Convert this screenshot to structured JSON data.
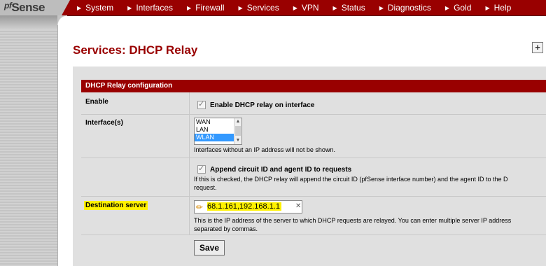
{
  "logo": {
    "prefix": "pf",
    "name": "Sense"
  },
  "nav": [
    {
      "label": "System"
    },
    {
      "label": "Interfaces"
    },
    {
      "label": "Firewall"
    },
    {
      "label": "Services"
    },
    {
      "label": "VPN"
    },
    {
      "label": "Status"
    },
    {
      "label": "Diagnostics"
    },
    {
      "label": "Gold"
    },
    {
      "label": "Help"
    }
  ],
  "page": {
    "title": "Services: DHCP Relay",
    "add_icon": "add-icon"
  },
  "section": {
    "header": "DHCP Relay configuration"
  },
  "enable": {
    "label": "Enable",
    "checked": true,
    "checkbox_label": "Enable DHCP relay on interface"
  },
  "interfaces": {
    "label": "Interface(s)",
    "options": [
      "WAN",
      "LAN",
      "WLAN"
    ],
    "selected": "WLAN",
    "help": "Interfaces without an IP address will not be shown."
  },
  "append": {
    "checked": true,
    "checkbox_label": "Append circuit ID and agent ID to requests",
    "help_line1": "If this is checked, the DHCP relay will append the circuit ID (pfSense interface number) and the agent ID to the D",
    "help_line2": "request."
  },
  "destination": {
    "label": "Destination server",
    "value": "68.1.161,192.168.1.1",
    "help_line1": "This is the IP address of the server to which DHCP requests are relayed. You can enter multiple server IP address",
    "help_line2": "separated by commas."
  },
  "save_label": "Save",
  "colors": {
    "brand": "#990000",
    "highlight": "#fff200",
    "selection": "#3399ff"
  }
}
